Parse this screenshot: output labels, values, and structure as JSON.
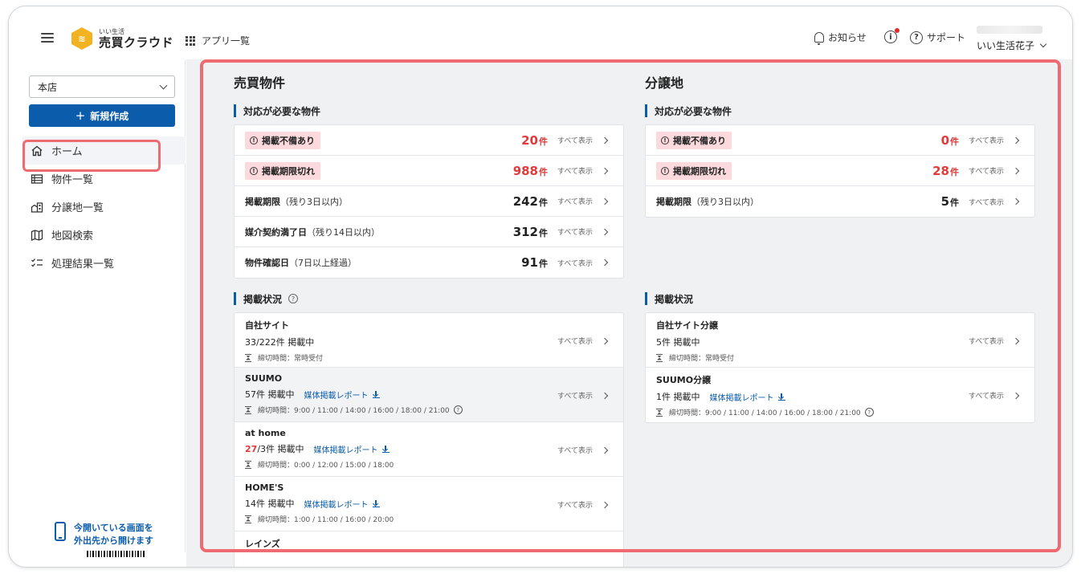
{
  "header": {
    "logo_mark": "≋",
    "logo_sub": "いい生活",
    "logo_main": "売買クラウド",
    "apps_label": "アプリ一覧",
    "notice_label": "お知らせ",
    "info_glyph": "i",
    "help_glyph": "?",
    "support_label": "サポート",
    "user_name": "いい生活花子"
  },
  "sidebar": {
    "store": "本店",
    "new_button": "新規作成",
    "plus": "+",
    "items": [
      {
        "label": "ホーム",
        "icon": "home-icon"
      },
      {
        "label": "物件一覧",
        "icon": "list-icon"
      },
      {
        "label": "分譲地一覧",
        "icon": "buildings-icon"
      },
      {
        "label": "地図検索",
        "icon": "map-icon"
      },
      {
        "label": "処理結果一覧",
        "icon": "checklist-icon"
      }
    ],
    "promo_line1": "今開いている画面を",
    "promo_line2": "外出先から開けます"
  },
  "baibai": {
    "title": "売買物件",
    "action_title": "対応が必要な物件",
    "see_all": "すべて表示",
    "unit": "件",
    "rows": [
      {
        "label": "掲載不備あり",
        "count": "20"
      },
      {
        "label": "掲載期限切れ",
        "count": "988"
      },
      {
        "label": "掲載期限",
        "sub": "（残り3日以内）",
        "count": "242"
      },
      {
        "label": "媒介契約満了日",
        "sub": "（残り14日以内）",
        "count": "312"
      },
      {
        "label": "物件確認日",
        "sub": "（7日以上経過）",
        "count": "91"
      }
    ],
    "status_title": "掲載状況",
    "status_help": "?",
    "publish": [
      {
        "name": "自社サイト",
        "line": "33/222件 掲載中",
        "deadline": "締切時間：常時受付"
      },
      {
        "name": "SUUMO",
        "line": "57件 掲載中",
        "report": "媒体掲載レポート",
        "deadline": "締切時間：9:00 / 11:00 / 14:00 / 16:00 / 18:00 / 21:00"
      },
      {
        "name": "at home",
        "line_red": "27",
        "line": "/3件 掲載中",
        "report": "媒体掲載レポート",
        "deadline": "締切時間：0:00 / 12:00 / 15:00 / 18:00"
      },
      {
        "name": "HOME'S",
        "line": "14件 掲載中",
        "report": "媒体掲載レポート",
        "deadline": "締切時間：1:00 / 11:00 / 16:00 / 20:00"
      },
      {
        "name": "レインズ"
      }
    ]
  },
  "bunjo": {
    "title": "分譲地",
    "action_title": "対応が必要な物件",
    "rows": [
      {
        "label": "掲載不備あり",
        "count": "0"
      },
      {
        "label": "掲載期限切れ",
        "count": "28"
      },
      {
        "label": "掲載期限",
        "sub": "（残り3日以内）",
        "count": "5"
      }
    ],
    "status_title": "掲載状況",
    "publish": [
      {
        "name": "自社サイト分譲",
        "line": "5件 掲載中",
        "deadline": "締切時間：常時受付"
      },
      {
        "name": "SUUMO分譲",
        "line": "1件 掲載中",
        "report": "媒体掲載レポート",
        "deadline": "締切時間：9:00 / 11:00 / 14:00 / 16:00 / 18:00 / 21:00"
      }
    ]
  },
  "colors": {
    "accent": "#0b5cab",
    "alert": "#e03a3a",
    "badge": "#fbd9dc",
    "highlight": "#ee6b72"
  }
}
